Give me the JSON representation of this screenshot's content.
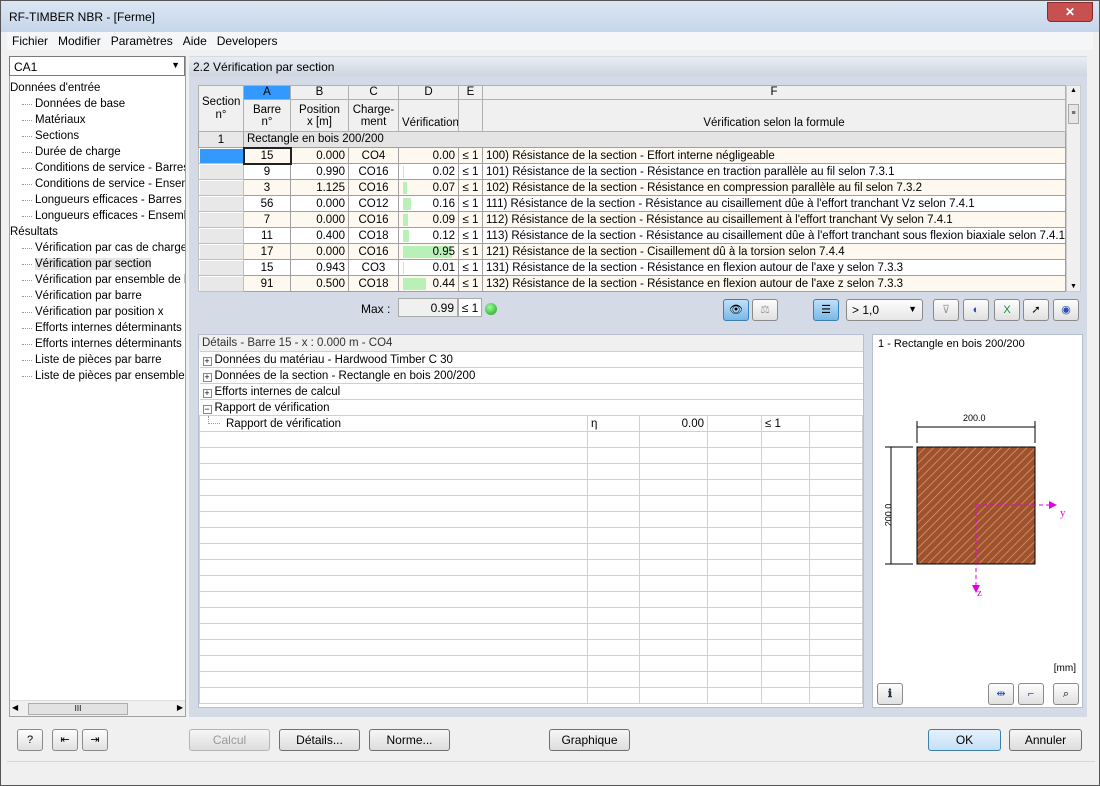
{
  "window": {
    "title": "RF-TIMBER NBR - [Ferme]",
    "close": "✕"
  },
  "menu": [
    "Fichier",
    "Modifier",
    "Paramètres",
    "Aide",
    "Developers"
  ],
  "case_select": "CA1",
  "tree": {
    "input_title": "Données d'entrée",
    "input_items": [
      "Données de base",
      "Matériaux",
      "Sections",
      "Durée de charge",
      "Conditions de service - Barres",
      "Conditions de service - Ensemble",
      "Longueurs efficaces - Barres",
      "Longueurs efficaces - Ensemble"
    ],
    "results_title": "Résultats",
    "results_items": [
      "Vérification par cas de charge",
      "Vérification par section",
      "Vérification par ensemble de barres",
      "Vérification par barre",
      "Vérification par position x",
      "Efforts internes déterminants par barre",
      "Efforts internes déterminants par ensemble",
      "Liste de pièces par barre",
      "Liste de pièces par ensemble de barres"
    ],
    "selected": "Vérification par section"
  },
  "panel_title": "2.2  Vérification par section",
  "table": {
    "letters": [
      "A",
      "B",
      "C",
      "D",
      "E",
      "F"
    ],
    "headers": {
      "section": [
        "Section",
        "n°"
      ],
      "a": [
        "Barre",
        "n°"
      ],
      "b": [
        "Position",
        "x [m]"
      ],
      "c": [
        "Charge-",
        "ment"
      ],
      "d": "Vérification",
      "f": "Vérification selon la formule"
    },
    "group": {
      "no": "1",
      "label": "Rectangle en bois 200/200"
    },
    "rows": [
      {
        "barre": "15",
        "x": "0.000",
        "charge": "CO4",
        "verif": "0.00",
        "le": "≤ 1",
        "formule": "100) Résistance de la section - Effort interne négligeable"
      },
      {
        "barre": "9",
        "x": "0.990",
        "charge": "CO16",
        "verif": "0.02",
        "le": "≤ 1",
        "formule": "101) Résistance de la section - Résistance en traction parallèle au fil selon 7.3.1"
      },
      {
        "barre": "3",
        "x": "1.125",
        "charge": "CO16",
        "verif": "0.07",
        "le": "≤ 1",
        "formule": "102) Résistance de la section - Résistance en compression parallèle au fil selon 7.3.2"
      },
      {
        "barre": "56",
        "x": "0.000",
        "charge": "CO12",
        "verif": "0.16",
        "le": "≤ 1",
        "formule": "111) Résistance de la section - Résistance au cisaillement dûe à l'effort tranchant Vz selon 7.4.1"
      },
      {
        "barre": "7",
        "x": "0.000",
        "charge": "CO16",
        "verif": "0.09",
        "le": "≤ 1",
        "formule": "112) Résistance de la section - Résistance au cisaillement à l'effort tranchant Vy selon 7.4.1"
      },
      {
        "barre": "11",
        "x": "0.400",
        "charge": "CO18",
        "verif": "0.12",
        "le": "≤ 1",
        "formule": "113) Résistance de la section - Résistance au cisaillement dûe à l'effort tranchant sous flexion biaxiale selon 7.4.1"
      },
      {
        "barre": "17",
        "x": "0.000",
        "charge": "CO16",
        "verif": "0.95",
        "le": "≤ 1",
        "formule": "121) Résistance de la section - Cisaillement dû à la torsion selon 7.4.4"
      },
      {
        "barre": "15",
        "x": "0.943",
        "charge": "CO3",
        "verif": "0.01",
        "le": "≤ 1",
        "formule": "131) Résistance de la section - Résistance en flexion autour de l'axe y selon 7.3.3"
      },
      {
        "barre": "91",
        "x": "0.500",
        "charge": "CO18",
        "verif": "0.44",
        "le": "≤ 1",
        "formule": "132) Résistance de la section - Résistance en flexion autour de l'axe z selon 7.3.3"
      }
    ],
    "max_label": "Max :",
    "max_value": "0.99",
    "max_le": "≤ 1"
  },
  "toolbar": {
    "filter_value": "> 1,0"
  },
  "details": {
    "title": "Détails - Barre 15 - x : 0.000 m - CO4",
    "groups": [
      "Données du matériau - Hardwood Timber C 30",
      "Données de la section - Rectangle en bois 200/200",
      "Efforts internes de calcul",
      "Rapport de vérification"
    ],
    "row": {
      "label": "Rapport de vérification",
      "symbol": "η",
      "value": "0.00",
      "le": "≤ 1"
    }
  },
  "graphic": {
    "title": "1 - Rectangle en bois 200/200",
    "width": "200.0",
    "height": "200.0",
    "axis_y": "y",
    "axis_z": "z",
    "unit": "[mm]",
    "section_color": "#a0522d"
  },
  "buttons": {
    "calc": "Calcul",
    "details": "Détails...",
    "norme": "Norme...",
    "graphique": "Graphique",
    "ok": "OK",
    "annuler": "Annuler"
  }
}
